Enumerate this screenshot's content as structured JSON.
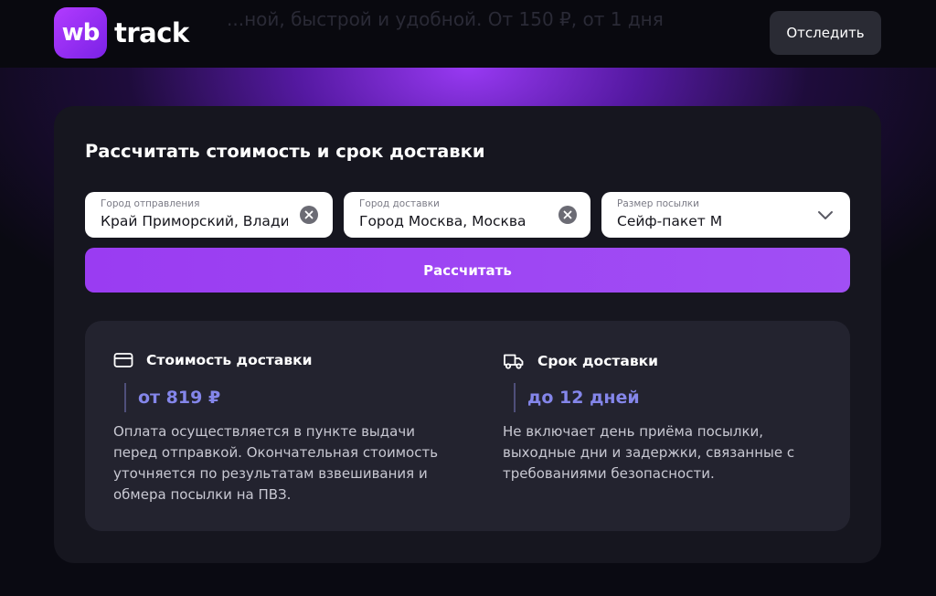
{
  "header": {
    "behind_text": "...ной, быстрой и удобной. От 150 ₽, от 1 дня",
    "logo_badge": "wb",
    "logo_word": "track",
    "track_button": "Отследить"
  },
  "calculator": {
    "title": "Рассчитать стоимость и срок доставки",
    "fields": [
      {
        "label": "Город отправления",
        "value": "Край Приморский, Влади",
        "icon": "clear-icon"
      },
      {
        "label": "Город доставки",
        "value": "Город Москва, Москва",
        "icon": "clear-icon"
      },
      {
        "label": "Размер посылки",
        "value": "Сейф-пакет M",
        "icon": "chevron-down-icon"
      }
    ],
    "submit_label": "Рассчитать"
  },
  "results": {
    "cost": {
      "icon": "card-icon",
      "title": "Стоимость доставки",
      "value": "от 819 ₽",
      "description": "Оплата осуществляется в пункте выдачи перед отправкой. Окончательная стоимость уточняется по результатам взвешивания и обмера посылки на ПВЗ."
    },
    "time": {
      "icon": "truck-icon",
      "title": "Срок доставки",
      "value": "до 12 дней",
      "description": "Не включает день приёма посылки, выходные дни и задержки, связанные с требованиями безопасности."
    }
  },
  "colors": {
    "accent": "#9a3cf2",
    "value_text": "#8486ea",
    "card_bg": "#16161f"
  }
}
